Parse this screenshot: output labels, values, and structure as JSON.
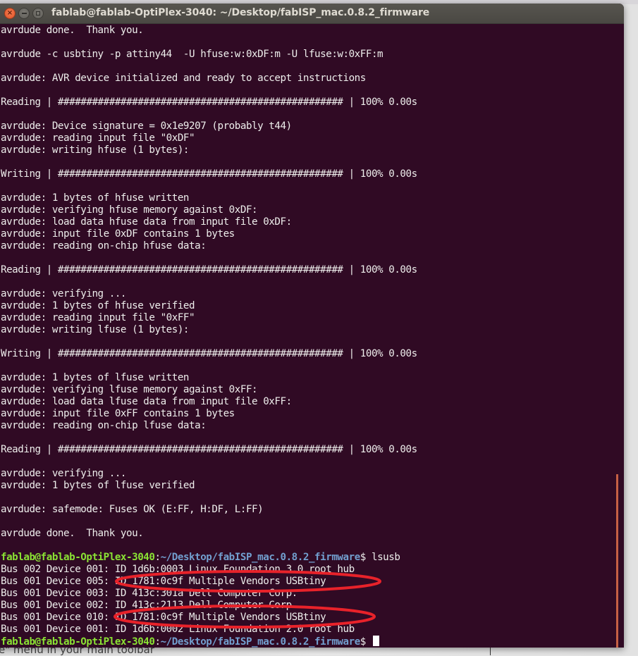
{
  "window": {
    "title": "fablab@fablab-OptiPlex-3040: ~/Desktop/fabISP_mac.0.8.2_firmware",
    "controls": {
      "close_glyph": "×",
      "minimize": "minimize",
      "maximize": "maximize"
    }
  },
  "terminal": {
    "colors": {
      "background": "#300a24",
      "foreground": "#eeeeec",
      "prompt_user": "#8ae234",
      "prompt_path": "#729fcf",
      "annotation": "#e8222a",
      "scroll_thumb": "#e0704a"
    },
    "prompt": {
      "user_host": "fablab@fablab-OptiPlex-3040",
      "separator": ":",
      "path": "~/Desktop/fabISP_mac.0.8.2_firmware",
      "dollar": "$"
    },
    "lines": [
      "avrdude done.  Thank you.",
      "",
      "avrdude -c usbtiny -p attiny44  -U hfuse:w:0xDF:m -U lfuse:w:0xFF:m",
      "",
      "avrdude: AVR device initialized and ready to accept instructions",
      "",
      "Reading | ################################################## | 100% 0.00s",
      "",
      "avrdude: Device signature = 0x1e9207 (probably t44)",
      "avrdude: reading input file \"0xDF\"",
      "avrdude: writing hfuse (1 bytes):",
      "",
      "Writing | ################################################## | 100% 0.00s",
      "",
      "avrdude: 1 bytes of hfuse written",
      "avrdude: verifying hfuse memory against 0xDF:",
      "avrdude: load data hfuse data from input file 0xDF:",
      "avrdude: input file 0xDF contains 1 bytes",
      "avrdude: reading on-chip hfuse data:",
      "",
      "Reading | ################################################## | 100% 0.00s",
      "",
      "avrdude: verifying ...",
      "avrdude: 1 bytes of hfuse verified",
      "avrdude: reading input file \"0xFF\"",
      "avrdude: writing lfuse (1 bytes):",
      "",
      "Writing | ################################################## | 100% 0.00s",
      "",
      "avrdude: 1 bytes of lfuse written",
      "avrdude: verifying lfuse memory against 0xFF:",
      "avrdude: load data lfuse data from input file 0xFF:",
      "avrdude: input file 0xFF contains 1 bytes",
      "avrdude: reading on-chip lfuse data:",
      "",
      "Reading | ################################################## | 100% 0.00s",
      "",
      "avrdude: verifying ...",
      "avrdude: 1 bytes of lfuse verified",
      "",
      "avrdude: safemode: Fuses OK (E:FF, H:DF, L:FF)",
      "",
      "avrdude done.  Thank you.",
      ""
    ],
    "command": " lsusb",
    "lsusb_output": [
      "Bus 002 Device 001: ID 1d6b:0003 Linux Foundation 3.0 root hub",
      "Bus 001 Device 005: ID 1781:0c9f Multiple Vendors USBtiny",
      "Bus 001 Device 003: ID 413c:301a Dell Computer Corp.",
      "Bus 001 Device 002: ID 413c:2113 Dell Computer Corp.",
      "Bus 001 Device 010: ID 1781:0c9f Multiple Vendors USBtiny",
      "Bus 001 Device 001: ID 1d6b:0002 Linux Foundation 2.0 root hub"
    ],
    "highlighted_devices": [
      "ID 1781:0c9f Multiple Vendors USBtiny (Bus 001 Device 005)",
      "ID 1781:0c9f Multiple Vendors USBtiny (Bus 001 Device 010)"
    ]
  },
  "background_page": {
    "visible_text": "e\" menu in your main toolbar"
  }
}
